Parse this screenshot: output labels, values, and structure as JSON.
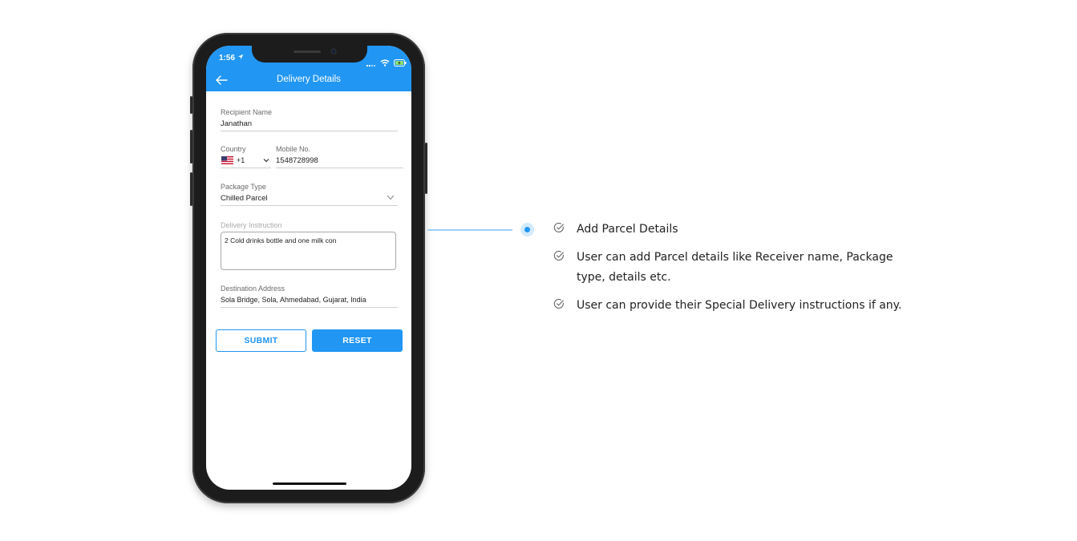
{
  "status_bar": {
    "time": "1:56"
  },
  "app_bar": {
    "title": "Delivery Details"
  },
  "form": {
    "recipient": {
      "label": "Recipient Name",
      "value": "Janathan"
    },
    "country": {
      "label": "Country",
      "code": "+1"
    },
    "mobile": {
      "label": "Mobile No.",
      "value": "1548728998"
    },
    "package": {
      "label": "Package Type",
      "value": "Chilled Parcel"
    },
    "instruction": {
      "label": "Delivery Instruction",
      "value": "2 Cold drinks bottle and one milk con"
    },
    "address": {
      "label": "Destination Address",
      "value": "Sola Bridge, Sola, Ahmedabad, Gujarat, India"
    },
    "buttons": {
      "submit": "SUBMIT",
      "reset": "RESET"
    }
  },
  "features": [
    {
      "text": "Add Parcel Details"
    },
    {
      "text": "User can add Parcel details like Receiver name, Package type, details etc."
    },
    {
      "text": "User can provide their Special Delivery instructions if any."
    }
  ],
  "colors": {
    "accent": "#2196f3",
    "connector": "#9bd0fb"
  },
  "icons": [
    "location-arrow-icon",
    "signal-icon",
    "wifi-icon",
    "battery-icon",
    "back-arrow-icon",
    "us-flag-icon",
    "chevron-down-icon",
    "check-circle-icon"
  ]
}
